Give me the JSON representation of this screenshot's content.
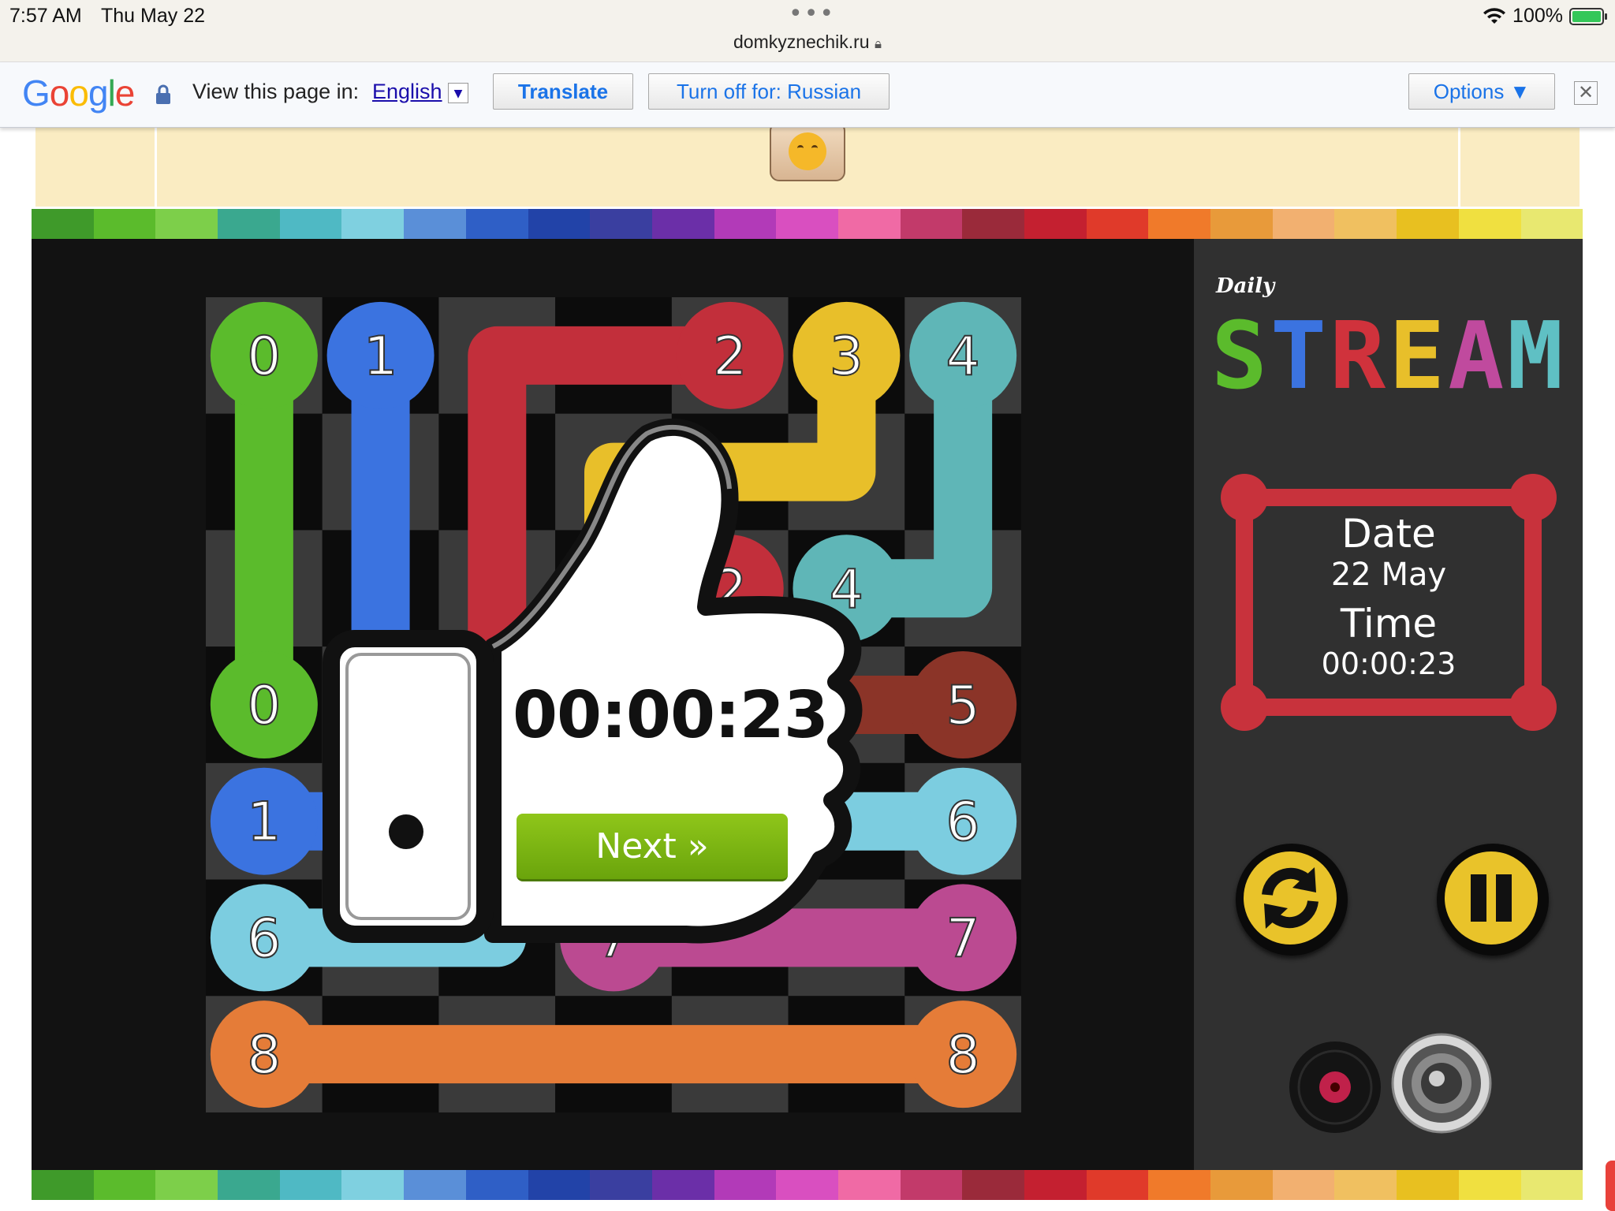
{
  "status_bar": {
    "time": "7:57 AM",
    "date": "Thu May 22",
    "dots": "•••",
    "url": "domkyznechik.ru",
    "battery": "100%"
  },
  "translate_bar": {
    "logo": "Google",
    "view_label": "View this page in:",
    "language": "English",
    "translate_button": "Translate",
    "turn_off_button": "Turn off for: Russian",
    "options_button": "Options ▼",
    "close_icon": "close-icon"
  },
  "game": {
    "logo_small": "Daily",
    "logo_letters": [
      "S",
      "T",
      "R",
      "E",
      "A",
      "M"
    ],
    "logo_colors": [
      "#5bbb2c",
      "#3b73e0",
      "#d0323c",
      "#e8bf2a",
      "#c04a9e",
      "#5fc0c4"
    ],
    "date_label": "Date",
    "date_value": "22 May",
    "time_label": "Time",
    "time_value": "00:00:23",
    "popup_time": "00:00:23",
    "next_button": "Next »",
    "controls": [
      "refresh-icon",
      "pause-icon",
      "music-icon",
      "speaker-icon"
    ]
  },
  "board": {
    "size": 7,
    "colors": {
      "0": "#5bbb2c",
      "1": "#3b73e0",
      "2": "#c22f3b",
      "3": "#e8bf2a",
      "4": "#5fb6b7",
      "5": "#8b3428",
      "6": "#7ccde0",
      "7": "#bb4a91",
      "8": "#e57c38"
    },
    "paths": [
      {
        "id": "0",
        "cells": [
          [
            0,
            0
          ],
          [
            1,
            0
          ],
          [
            2,
            0
          ],
          [
            3,
            0
          ]
        ]
      },
      {
        "id": "1",
        "cells": [
          [
            0,
            1
          ],
          [
            1,
            1
          ],
          [
            2,
            1
          ],
          [
            3,
            1
          ],
          [
            4,
            1
          ],
          [
            4,
            0
          ]
        ]
      },
      {
        "id": "2",
        "cells": [
          [
            0,
            4
          ],
          [
            0,
            3
          ],
          [
            0,
            2
          ],
          [
            1,
            2
          ],
          [
            2,
            2
          ],
          [
            3,
            2
          ],
          [
            3,
            3
          ],
          [
            2,
            3
          ],
          [
            2,
            4
          ]
        ]
      },
      {
        "id": "3",
        "cells": [
          [
            0,
            5
          ],
          [
            1,
            5
          ],
          [
            1,
            4
          ],
          [
            1,
            3
          ],
          [
            2,
            3
          ]
        ]
      },
      {
        "id": "4",
        "cells": [
          [
            0,
            6
          ],
          [
            1,
            6
          ],
          [
            2,
            6
          ],
          [
            2,
            5
          ]
        ]
      },
      {
        "id": "5",
        "cells": [
          [
            3,
            6
          ],
          [
            3,
            5
          ],
          [
            3,
            4
          ]
        ]
      },
      {
        "id": "6",
        "cells": [
          [
            4,
            6
          ],
          [
            4,
            5
          ],
          [
            4,
            4
          ],
          [
            4,
            3
          ],
          [
            4,
            2
          ],
          [
            5,
            2
          ],
          [
            5,
            1
          ],
          [
            5,
            0
          ]
        ]
      },
      {
        "id": "7",
        "cells": [
          [
            5,
            6
          ],
          [
            5,
            5
          ],
          [
            5,
            4
          ],
          [
            5,
            3
          ]
        ]
      },
      {
        "id": "8",
        "cells": [
          [
            6,
            0
          ],
          [
            6,
            1
          ],
          [
            6,
            2
          ],
          [
            6,
            3
          ],
          [
            6,
            4
          ],
          [
            6,
            5
          ],
          [
            6,
            6
          ]
        ]
      }
    ],
    "endpoints": [
      {
        "id": "0",
        "cells": [
          [
            0,
            0
          ],
          [
            3,
            0
          ]
        ]
      },
      {
        "id": "1",
        "cells": [
          [
            0,
            1
          ],
          [
            4,
            0
          ]
        ]
      },
      {
        "id": "2",
        "cells": [
          [
            0,
            4
          ],
          [
            2,
            4
          ]
        ]
      },
      {
        "id": "3",
        "cells": [
          [
            0,
            5
          ],
          [
            2,
            3
          ]
        ]
      },
      {
        "id": "4",
        "cells": [
          [
            0,
            6
          ],
          [
            2,
            5
          ]
        ]
      },
      {
        "id": "5",
        "cells": [
          [
            3,
            6
          ],
          [
            3,
            4
          ]
        ]
      },
      {
        "id": "6",
        "cells": [
          [
            4,
            6
          ],
          [
            5,
            0
          ]
        ]
      },
      {
        "id": "7",
        "cells": [
          [
            5,
            6
          ],
          [
            5,
            3
          ]
        ]
      },
      {
        "id": "8",
        "cells": [
          [
            6,
            0
          ],
          [
            6,
            6
          ]
        ]
      }
    ]
  }
}
